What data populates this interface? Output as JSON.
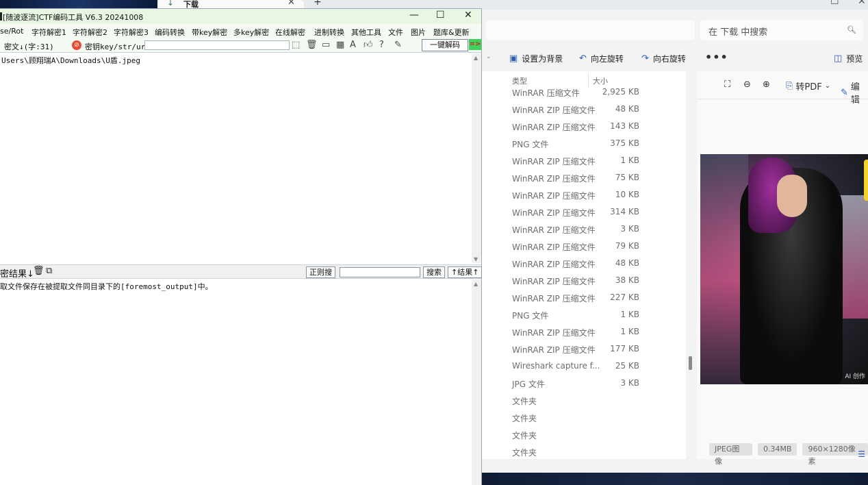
{
  "ctf": {
    "title": "[随波逐流]CTF编码工具 V6.3 20241008",
    "window_controls": [
      "—",
      "☐",
      "✕"
    ],
    "menu": [
      "se/Rot",
      "字符解密1",
      "字符解密2",
      "字符解密3",
      "编码转换",
      "带key解密",
      "多key解密",
      "在线解密",
      "进制转换",
      "其他工具",
      "文件",
      "图片",
      "题库&更新"
    ],
    "cipher_label": "密文↓(字:31)",
    "key_label": "密钥key/str/url:",
    "key_value": "",
    "decode_button": "一键解码",
    "go_arrow": "=>",
    "cipher_text": "Users\\顾翔瑞A\\Downloads\\U盾.jpeg",
    "result_label": "密结果↓",
    "regex_search_button": "正则搜",
    "search_value": "",
    "search_button": "搜索",
    "result_up_button": "↑结果↑",
    "result_text": "取文件保存在被提取文件同目录下的[foremost_output]中。"
  },
  "explorer": {
    "tab_title": "下载",
    "search_placeholder": "在 下载 中搜索",
    "toolbar": {
      "set_background": "设置为背景",
      "rotate_left": "向左旋转",
      "rotate_right": "向右旋转",
      "more": "•••",
      "preview": "预览"
    },
    "columns": {
      "type": "类型",
      "size": "大小"
    },
    "files": [
      {
        "type": "WinRAR 压缩文件",
        "size": "2,925 KB"
      },
      {
        "type": "WinRAR ZIP 压缩文件",
        "size": "48 KB"
      },
      {
        "type": "WinRAR ZIP 压缩文件",
        "size": "143 KB"
      },
      {
        "type": "PNG 文件",
        "size": "375 KB"
      },
      {
        "type": "WinRAR ZIP 压缩文件",
        "size": "1 KB"
      },
      {
        "type": "WinRAR ZIP 压缩文件",
        "size": "75 KB"
      },
      {
        "type": "WinRAR ZIP 压缩文件",
        "size": "10 KB"
      },
      {
        "type": "WinRAR ZIP 压缩文件",
        "size": "314 KB"
      },
      {
        "type": "WinRAR ZIP 压缩文件",
        "size": "3 KB"
      },
      {
        "type": "WinRAR ZIP 压缩文件",
        "size": "79 KB"
      },
      {
        "type": "WinRAR ZIP 压缩文件",
        "size": "48 KB"
      },
      {
        "type": "WinRAR ZIP 压缩文件",
        "size": "38 KB"
      },
      {
        "type": "WinRAR ZIP 压缩文件",
        "size": "227 KB"
      },
      {
        "type": "PNG 文件",
        "size": "1 KB"
      },
      {
        "type": "WinRAR ZIP 压缩文件",
        "size": "1 KB"
      },
      {
        "type": "WinRAR ZIP 压缩文件",
        "size": "177 KB"
      },
      {
        "type": "Wireshark capture f...",
        "size": "25 KB"
      },
      {
        "type": "JPG 文件",
        "size": "3 KB"
      },
      {
        "type": "文件夹",
        "size": ""
      },
      {
        "type": "文件夹",
        "size": ""
      },
      {
        "type": "文件夹",
        "size": ""
      },
      {
        "type": "文件夹",
        "size": ""
      }
    ],
    "preview": {
      "to_pdf": "转PDF",
      "edit": "编辑",
      "ai_badge": "AI 创作",
      "chips": [
        "JPEG图像",
        "0.34MB",
        "960×1280像素"
      ]
    }
  }
}
